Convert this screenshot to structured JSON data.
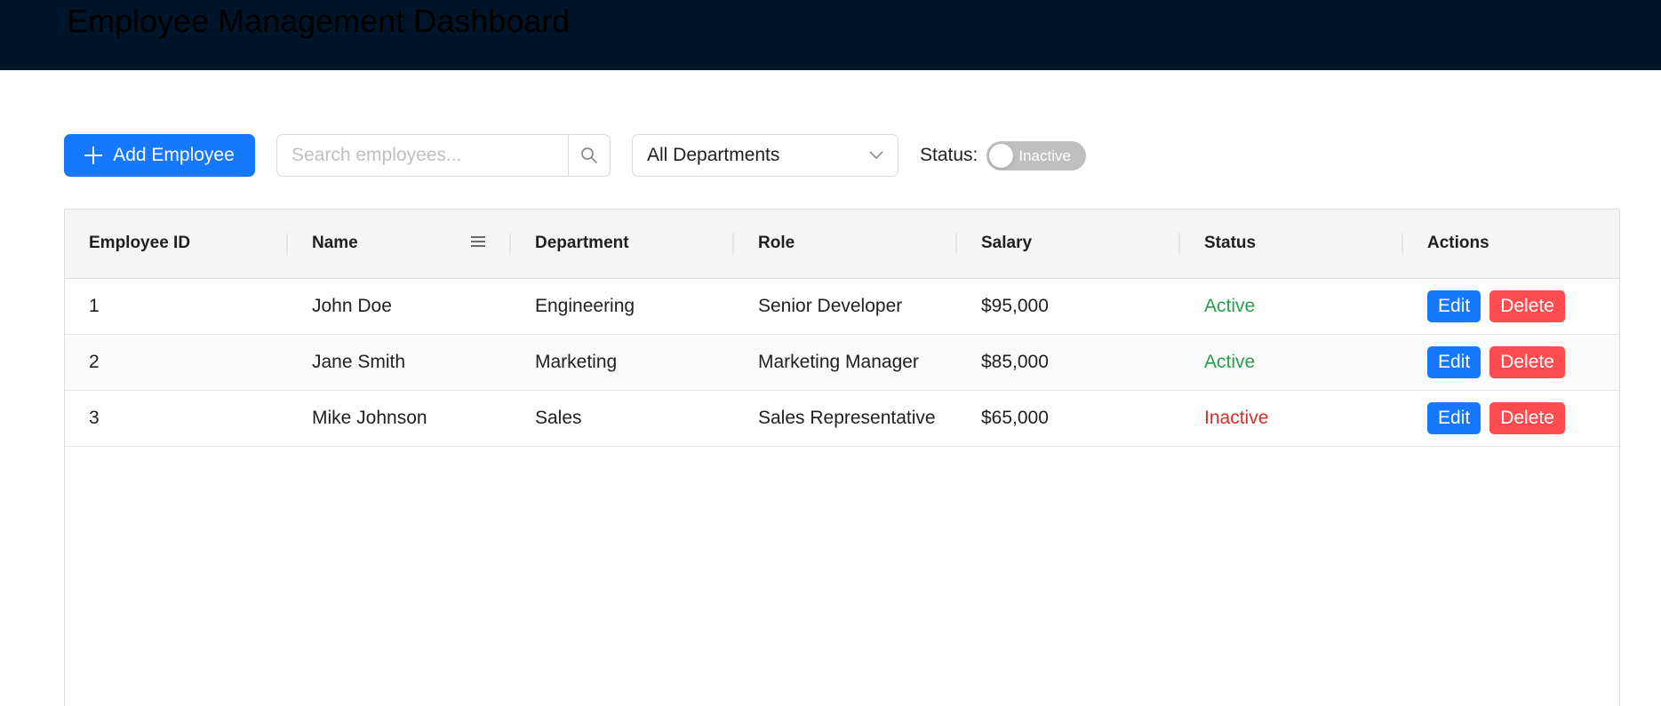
{
  "header": {
    "title": "Employee Management Dashboard",
    "background_color": "#001529"
  },
  "toolbar": {
    "add_button_label": "Add Employee",
    "add_button_icon": "plus-icon",
    "search_placeholder": "Search employees...",
    "search_value": "",
    "search_icon": "search-icon",
    "department_selected": "All Departments",
    "department_icon": "chevron-down-icon",
    "status_label": "Status:",
    "status_toggle_text": "Inactive",
    "status_toggle_on": false
  },
  "table": {
    "columns": [
      {
        "label": "Employee ID"
      },
      {
        "label": "Name",
        "menu_icon": "menu-icon"
      },
      {
        "label": "Department"
      },
      {
        "label": "Role"
      },
      {
        "label": "Salary"
      },
      {
        "label": "Status"
      },
      {
        "label": "Actions"
      }
    ],
    "rows": [
      {
        "id": "1",
        "name": "John Doe",
        "department": "Engineering",
        "role": "Senior Developer",
        "salary": "$95,000",
        "status": "Active",
        "edit": "Edit",
        "delete": "Delete"
      },
      {
        "id": "2",
        "name": "Jane Smith",
        "department": "Marketing",
        "role": "Marketing Manager",
        "salary": "$85,000",
        "status": "Active",
        "edit": "Edit",
        "delete": "Delete"
      },
      {
        "id": "3",
        "name": "Mike Johnson",
        "department": "Sales",
        "role": "Sales Representative",
        "salary": "$65,000",
        "status": "Inactive",
        "edit": "Edit",
        "delete": "Delete"
      }
    ]
  },
  "colors": {
    "primary": "#1677ff",
    "danger": "#ff4d4f",
    "active": "#2a9d4a",
    "inactive": "#d32f2f"
  }
}
